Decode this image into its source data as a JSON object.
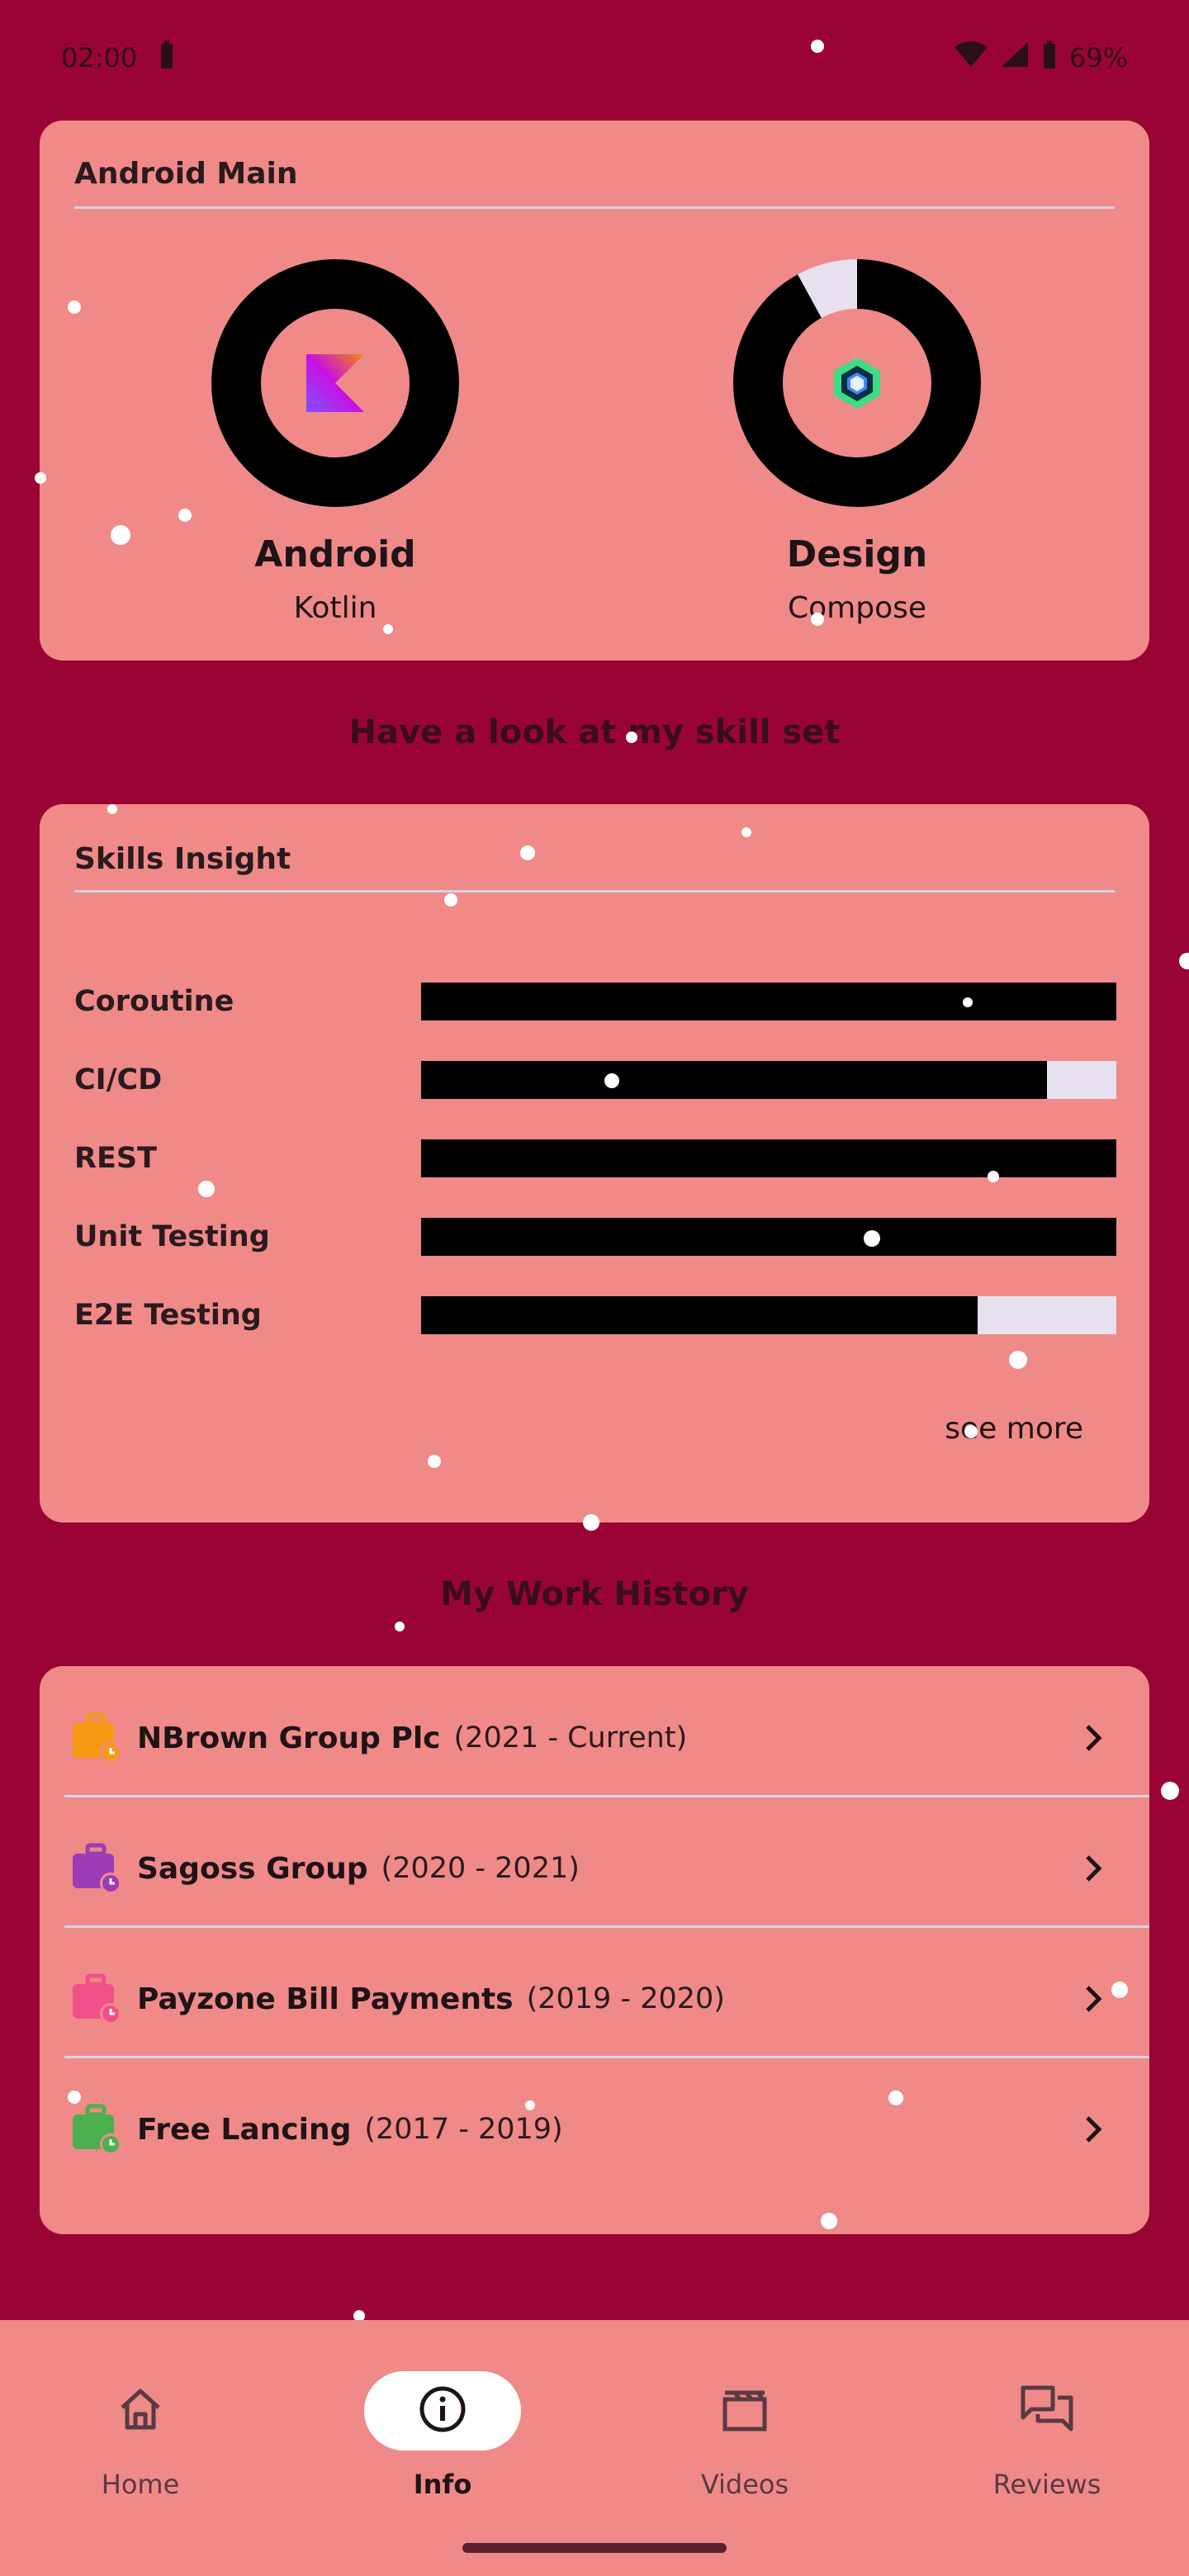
{
  "status": {
    "time": "02:00",
    "battery": "69%"
  },
  "main_card": {
    "title": "Android Main",
    "items": [
      {
        "name": "Android",
        "sub": "Kotlin",
        "progress": 1.0
      },
      {
        "name": "Design",
        "sub": "Compose",
        "progress": 0.92
      }
    ]
  },
  "skills_heading": "Have a look at my skill set",
  "skills_card": {
    "title": "Skills Insight",
    "items": [
      {
        "label": "Coroutine",
        "level": 1.0
      },
      {
        "label": "CI/CD",
        "level": 0.9
      },
      {
        "label": "REST",
        "level": 1.0
      },
      {
        "label": "Unit Testing",
        "level": 1.0
      },
      {
        "label": "E2E Testing",
        "level": 0.8
      }
    ],
    "see_more": "see more"
  },
  "work_heading": "My Work History",
  "work": [
    {
      "company": "NBrown Group Plc",
      "years": "(2021 - Current)",
      "icon_color": "#f59a12"
    },
    {
      "company": "Sagoss Group",
      "years": "(2020 - 2021)",
      "icon_color": "#9c3bb5"
    },
    {
      "company": "Payzone Bill Payments",
      "years": "(2019 - 2020)",
      "icon_color": "#f0508a"
    },
    {
      "company": "Free Lancing",
      "years": "(2017 - 2019)",
      "icon_color": "#4caf50"
    }
  ],
  "nav": [
    {
      "label": "Home",
      "icon": "home-icon",
      "active": false
    },
    {
      "label": "Info",
      "icon": "info-icon",
      "active": true
    },
    {
      "label": "Videos",
      "icon": "videos-icon",
      "active": false
    },
    {
      "label": "Reviews",
      "icon": "reviews-icon",
      "active": false
    }
  ],
  "colors": {
    "background": "#9a0434",
    "card": "#ef8a89",
    "ring": "#000000",
    "ring_track": "#e6e0ef"
  }
}
